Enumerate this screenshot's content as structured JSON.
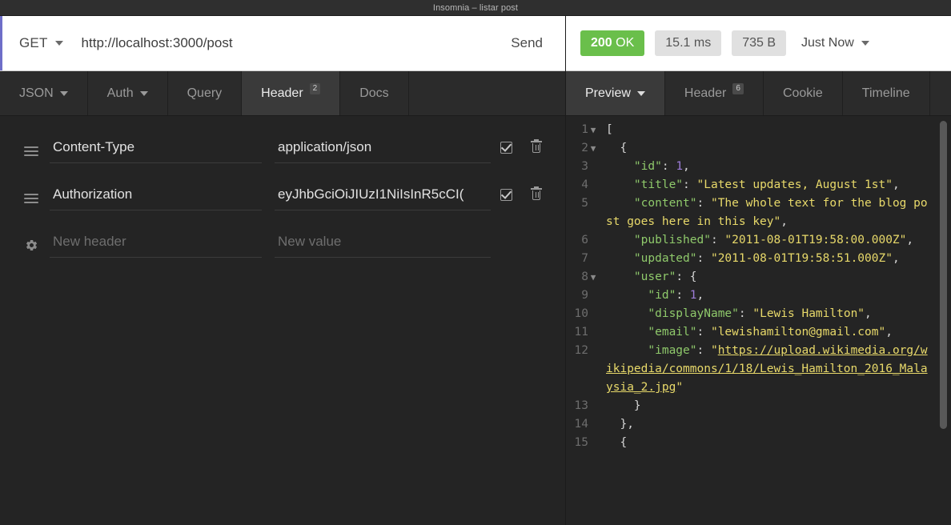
{
  "window": {
    "title": "Insomnia – listar post"
  },
  "request": {
    "method": "GET",
    "url": "http://localhost:3000/post",
    "send_label": "Send",
    "tabs": [
      {
        "label": "JSON",
        "badge": "",
        "dropdown": true,
        "active": false,
        "name": "tab-json"
      },
      {
        "label": "Auth",
        "badge": "",
        "dropdown": true,
        "active": false,
        "name": "tab-auth"
      },
      {
        "label": "Query",
        "badge": "",
        "dropdown": false,
        "active": false,
        "name": "tab-query"
      },
      {
        "label": "Header",
        "badge": "2",
        "dropdown": false,
        "active": true,
        "name": "tab-header"
      },
      {
        "label": "Docs",
        "badge": "",
        "dropdown": false,
        "active": false,
        "name": "tab-docs"
      }
    ],
    "headers": [
      {
        "name": "Content-Type",
        "value": "application/json",
        "enabled": true,
        "handle": "drag-handle-icon"
      },
      {
        "name": "Authorization",
        "value": "eyJhbGciOiJIUzI1NiIsInR5cCI(",
        "enabled": true,
        "handle": "drag-handle-icon"
      }
    ],
    "new_header": {
      "name_placeholder": "New header",
      "value_placeholder": "New value",
      "handle": "gear-icon"
    }
  },
  "response": {
    "status": {
      "code": "200",
      "text": "OK"
    },
    "time": "15.1 ms",
    "size": "735 B",
    "history_label": "Just Now",
    "tabs": [
      {
        "label": "Preview",
        "badge": "",
        "dropdown": true,
        "active": true,
        "name": "tab-preview"
      },
      {
        "label": "Header",
        "badge": "6",
        "dropdown": false,
        "active": false,
        "name": "tab-response-header"
      },
      {
        "label": "Cookie",
        "badge": "",
        "dropdown": false,
        "active": false,
        "name": "tab-cookie"
      },
      {
        "label": "Timeline",
        "badge": "",
        "dropdown": false,
        "active": false,
        "name": "tab-timeline"
      }
    ],
    "body_lines": [
      {
        "num": "1",
        "fold": true,
        "tokens": [
          {
            "t": "p",
            "v": "["
          }
        ]
      },
      {
        "num": "2",
        "fold": true,
        "tokens": [
          {
            "t": "p",
            "v": "  {"
          }
        ]
      },
      {
        "num": "3",
        "fold": false,
        "tokens": [
          {
            "t": "k",
            "v": "    \"id\""
          },
          {
            "t": "p",
            "v": ": "
          },
          {
            "t": "n",
            "v": "1"
          },
          {
            "t": "p",
            "v": ","
          }
        ]
      },
      {
        "num": "4",
        "fold": false,
        "tokens": [
          {
            "t": "k",
            "v": "    \"title\""
          },
          {
            "t": "p",
            "v": ": "
          },
          {
            "t": "s",
            "v": "\"Latest updates, August 1st\""
          },
          {
            "t": "p",
            "v": ","
          }
        ]
      },
      {
        "num": "5",
        "fold": false,
        "tokens": [
          {
            "t": "k",
            "v": "    \"content\""
          },
          {
            "t": "p",
            "v": ": "
          },
          {
            "t": "s",
            "v": "\"The whole text for the blog post goes here in this key\""
          },
          {
            "t": "p",
            "v": ","
          }
        ]
      },
      {
        "num": "6",
        "fold": false,
        "tokens": [
          {
            "t": "k",
            "v": "    \"published\""
          },
          {
            "t": "p",
            "v": ": "
          },
          {
            "t": "s",
            "v": "\"2011-08-01T19:58:00.000Z\""
          },
          {
            "t": "p",
            "v": ","
          }
        ]
      },
      {
        "num": "7",
        "fold": false,
        "tokens": [
          {
            "t": "k",
            "v": "    \"updated\""
          },
          {
            "t": "p",
            "v": ": "
          },
          {
            "t": "s",
            "v": "\"2011-08-01T19:58:51.000Z\""
          },
          {
            "t": "p",
            "v": ","
          }
        ]
      },
      {
        "num": "8",
        "fold": true,
        "tokens": [
          {
            "t": "k",
            "v": "    \"user\""
          },
          {
            "t": "p",
            "v": ": {"
          }
        ]
      },
      {
        "num": "9",
        "fold": false,
        "tokens": [
          {
            "t": "k",
            "v": "      \"id\""
          },
          {
            "t": "p",
            "v": ": "
          },
          {
            "t": "n",
            "v": "1"
          },
          {
            "t": "p",
            "v": ","
          }
        ]
      },
      {
        "num": "10",
        "fold": false,
        "tokens": [
          {
            "t": "k",
            "v": "      \"displayName\""
          },
          {
            "t": "p",
            "v": ": "
          },
          {
            "t": "s",
            "v": "\"Lewis Hamilton\""
          },
          {
            "t": "p",
            "v": ","
          }
        ]
      },
      {
        "num": "11",
        "fold": false,
        "tokens": [
          {
            "t": "k",
            "v": "      \"email\""
          },
          {
            "t": "p",
            "v": ": "
          },
          {
            "t": "s",
            "v": "\"lewishamilton@gmail.com\""
          },
          {
            "t": "p",
            "v": ","
          }
        ]
      },
      {
        "num": "12",
        "fold": false,
        "tokens": [
          {
            "t": "k",
            "v": "      \"image\""
          },
          {
            "t": "p",
            "v": ": "
          },
          {
            "t": "s",
            "v": "\""
          },
          {
            "t": "lnk",
            "v": "https://upload.wikimedia.org/wikipedia/commons/1/18/Lewis_Hamilton_2016_Malaysia_2.jpg"
          },
          {
            "t": "s",
            "v": "\""
          }
        ]
      },
      {
        "num": "13",
        "fold": false,
        "tokens": [
          {
            "t": "p",
            "v": "    }"
          }
        ]
      },
      {
        "num": "14",
        "fold": false,
        "tokens": [
          {
            "t": "p",
            "v": "  },"
          }
        ]
      },
      {
        "num": "15",
        "fold": false,
        "tokens": [
          {
            "t": "p",
            "v": "  {"
          }
        ]
      }
    ]
  },
  "colors": {
    "status_ok": "#6abf4b",
    "accent_bar": "#6e6ec8",
    "panel_bg": "#242424",
    "tab_active_bg": "#3a3a3a",
    "json_key": "#8fc96b",
    "json_string": "#e8d96a",
    "json_number": "#9d7cd8"
  }
}
